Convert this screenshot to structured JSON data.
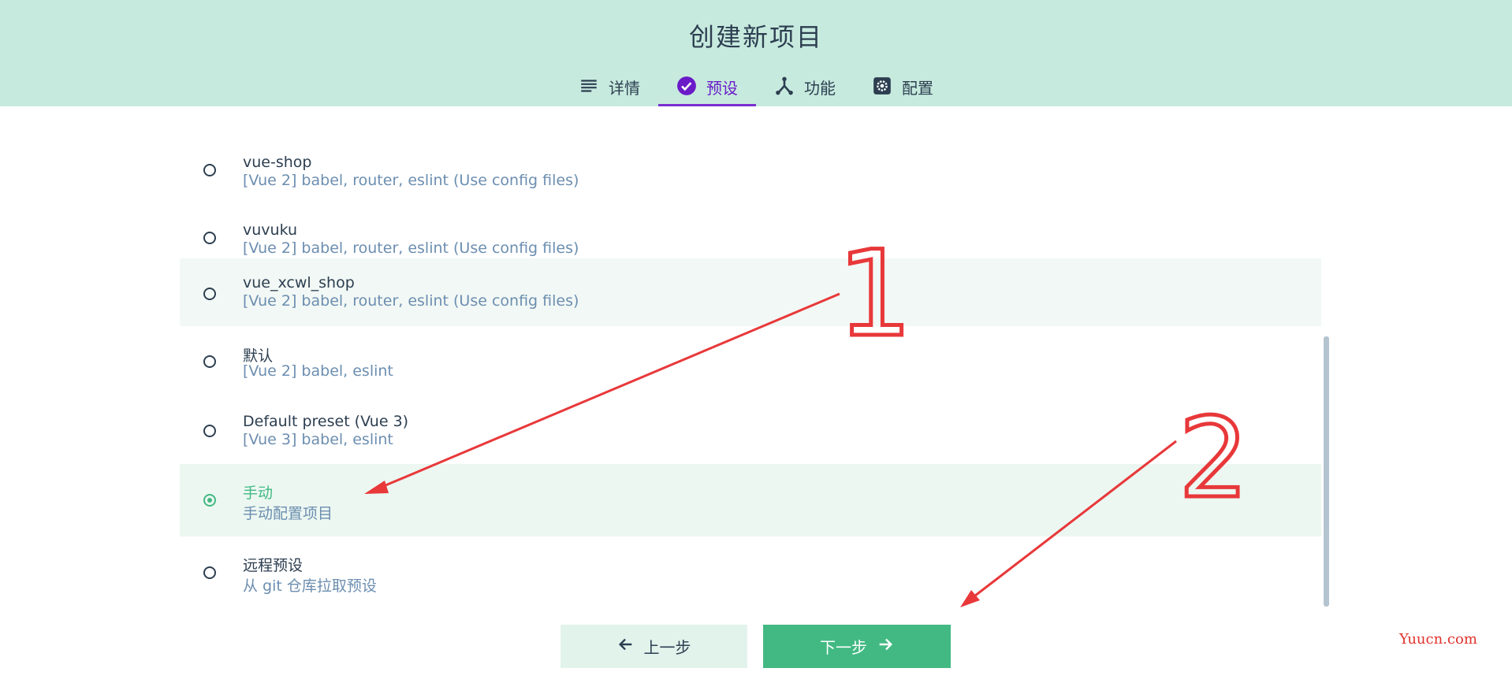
{
  "page": {
    "title": "创建新项目"
  },
  "tabs": [
    {
      "label": "详情",
      "icon": "list-icon",
      "active": false
    },
    {
      "label": "预设",
      "icon": "check-circle-icon",
      "active": true
    },
    {
      "label": "功能",
      "icon": "fork-icon",
      "active": false
    },
    {
      "label": "配置",
      "icon": "gear-icon",
      "active": false
    }
  ],
  "presets": [
    {
      "name": "vue-shop",
      "description": "[Vue 2] babel, router, eslint (Use config files)",
      "selected": false
    },
    {
      "name": "vuvuku",
      "description": "[Vue 2] babel, router, eslint (Use config files)",
      "selected": false
    },
    {
      "name": "vue_xcwl_shop",
      "description": "[Vue 2] babel, router, eslint (Use config files)",
      "selected": false
    },
    {
      "name": "默认",
      "description": "[Vue 2] babel, eslint",
      "selected": false
    },
    {
      "name": "Default preset (Vue 3)",
      "description": "[Vue 3] babel, eslint",
      "selected": false
    },
    {
      "name": "手动",
      "description": "手动配置项目",
      "selected": true
    },
    {
      "name": "远程预设",
      "description": "从 git 仓库拉取预设",
      "selected": false
    }
  ],
  "buttons": {
    "prev_label": "上一步",
    "next_label": "下一步"
  },
  "annotations": {
    "mark_1": "1",
    "mark_2": "2"
  },
  "watermark": "Yuucn.com",
  "colors": {
    "header_bg": "#c7eade",
    "accent": "#42b983",
    "tab_active": "#6a1bc7",
    "annotation": "#e8383a"
  }
}
